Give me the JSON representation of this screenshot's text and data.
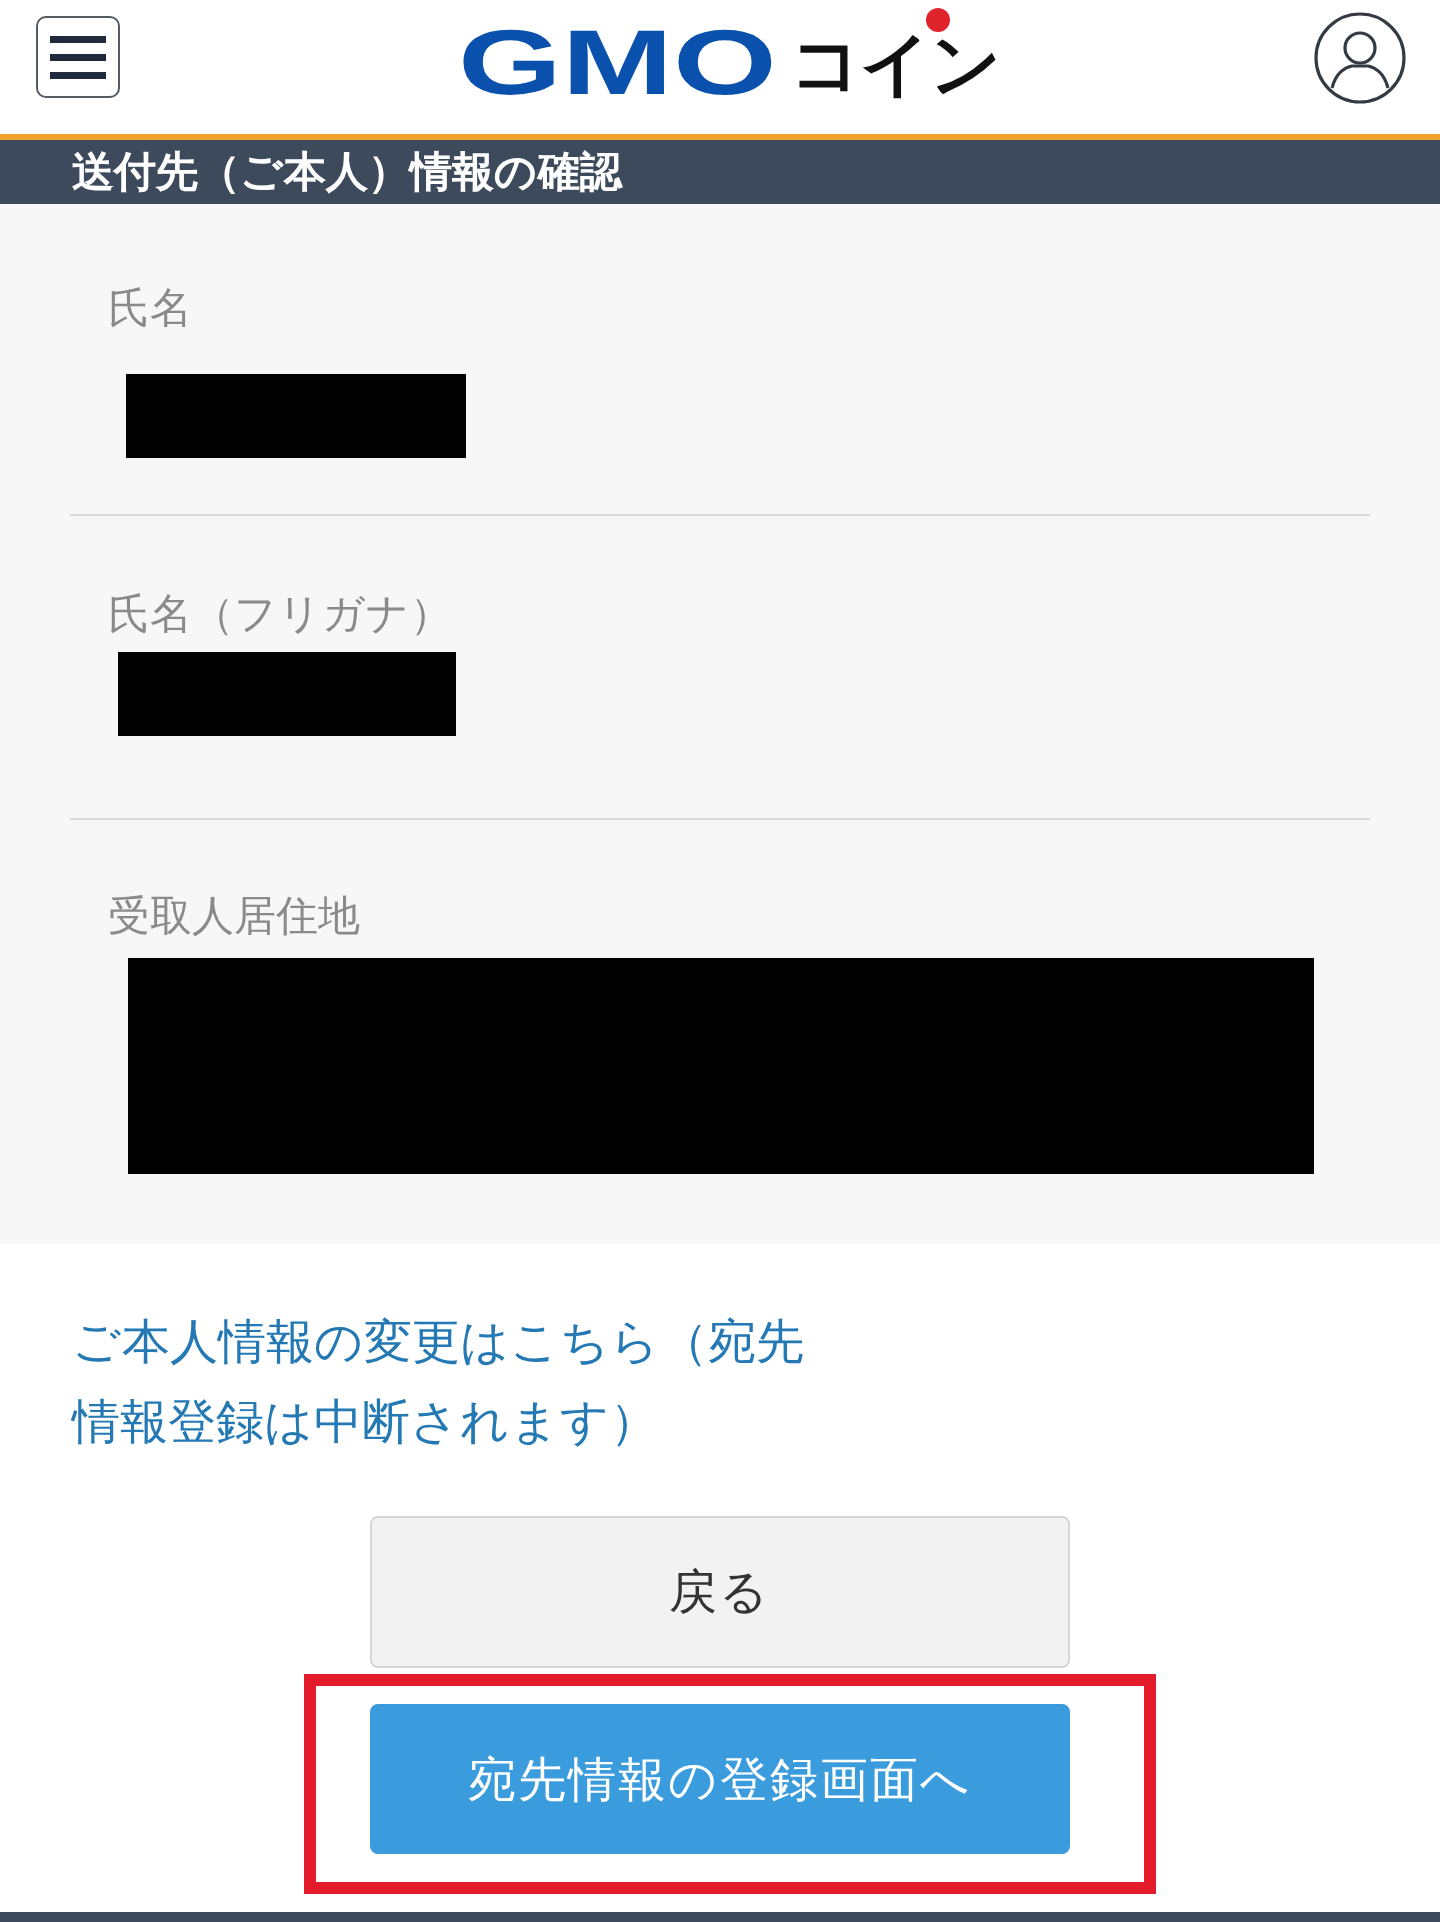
{
  "logo": {
    "mark": "GMO",
    "name": "コイン"
  },
  "page_title": "送付先（ご本人）情報の確認",
  "fields": [
    {
      "label": "氏名",
      "redacted": true
    },
    {
      "label": "氏名（フリガナ）",
      "redacted": true
    },
    {
      "label": "受取人居住地",
      "redacted": true
    }
  ],
  "change_link": "ご本人情報の変更はこちら（宛先情報登録は中断されます）",
  "buttons": [
    {
      "label": "戻る",
      "kind": "secondary",
      "highlighted": false
    },
    {
      "label": "宛先情報の登録画面へ",
      "kind": "primary",
      "highlighted": true
    }
  ]
}
